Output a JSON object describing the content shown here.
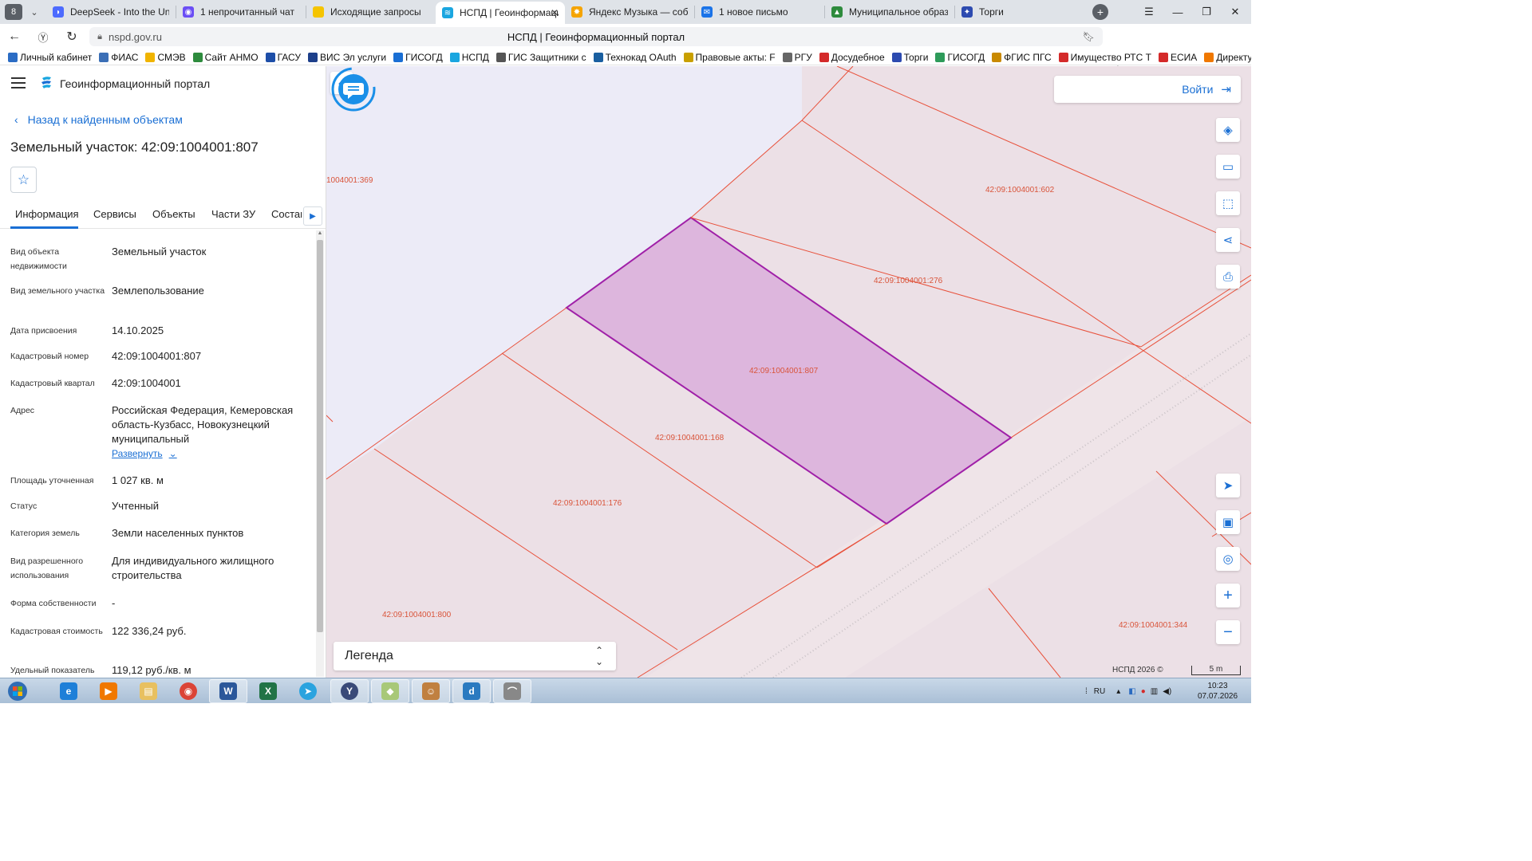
{
  "browser": {
    "tab_count": "8",
    "tabs": [
      {
        "label": "DeepSeek - Into the Unkno",
        "color": "#4d6bfe"
      },
      {
        "label": "1 непрочитанный чат",
        "color": "#6b4ef5"
      },
      {
        "label": "Исходящие запросы",
        "color": "#f5c400"
      },
      {
        "label": "НСПД | Геоинформаци",
        "color": "#1aa6e0"
      },
      {
        "label": "Яндекс Музыка — собира",
        "color": "#f5a400"
      },
      {
        "label": "1 новое письмо",
        "color": "#1a73e8"
      },
      {
        "label": "Муниципальное образов",
        "color": "#2e8b3d"
      },
      {
        "label": "Торги",
        "color": "#2d4bb0"
      }
    ],
    "tab_close": "✕",
    "new_tab": "+",
    "url": "nspd.gov.ru",
    "page_title": "НСПД | Геоинформационный портал",
    "bookmarks": [
      {
        "label": "Личный кабинет",
        "color": "#2b6cc4"
      },
      {
        "label": "ФИАС",
        "color": "#3b6fb6"
      },
      {
        "label": "СМЭВ",
        "color": "#f0b400"
      },
      {
        "label": "Сайт АНМО",
        "color": "#2e8b3d"
      },
      {
        "label": "ГАСУ",
        "color": "#1d4ea8"
      },
      {
        "label": "ВИС Эл услуги",
        "color": "#1d3f8a"
      },
      {
        "label": "ГИСОГД",
        "color": "#1a6fd4"
      },
      {
        "label": "НСПД",
        "color": "#1aa6e0"
      },
      {
        "label": "ГИС Защитники с",
        "color": "#555555"
      },
      {
        "label": "Технокад OAuth",
        "color": "#1a5fa0"
      },
      {
        "label": "Правовые акты: F",
        "color": "#c9a000"
      },
      {
        "label": "РГУ",
        "color": "#666666"
      },
      {
        "label": "Досудебное",
        "color": "#d42a2a"
      },
      {
        "label": "Торги",
        "color": "#2d4bb0"
      },
      {
        "label": "ГИСОГД",
        "color": "#2e9b5a"
      },
      {
        "label": "ФГИС ПГС",
        "color": "#c98a00"
      },
      {
        "label": "Имущество РТС Т",
        "color": "#d42a2a"
      },
      {
        "label": "ЕСИА",
        "color": "#d42a2a"
      },
      {
        "label": "Директум РХ",
        "color": "#f07800"
      }
    ]
  },
  "panel": {
    "portal_title": "Геоинформационный портал",
    "back_link": "Назад к найденным объектам",
    "object_title": "Земельный участок: 42:09:1004001:807",
    "tabs": [
      "Информация",
      "Сервисы",
      "Объекты",
      "Части ЗУ",
      "Состав"
    ],
    "properties": [
      {
        "key": "Вид объекта недвижимости",
        "value": "Земельный участок"
      },
      {
        "key": "Вид земельного участка",
        "value": "Землепользование"
      },
      {
        "key": "Дата присвоения",
        "value": "14.10.2025"
      },
      {
        "key": "Кадастровый номер",
        "value": "42:09:1004001:807"
      },
      {
        "key": "Кадастровый квартал",
        "value": "42:09:1004001"
      },
      {
        "key": "Адрес",
        "value": "Российская Федерация, Кемеровская область-Кузбасс, Новокузнецкий муниципальный"
      },
      {
        "key": "Площадь уточненная",
        "value": "1 027 кв. м"
      },
      {
        "key": "Статус",
        "value": "Учтенный"
      },
      {
        "key": "Категория земель",
        "value": "Земли населенных пунктов"
      },
      {
        "key": "Вид разрешенного использования",
        "value": "Для индивидуального жилищного строительства"
      },
      {
        "key": "Форма собственности",
        "value": "-"
      },
      {
        "key": "Кадастровая стоимость",
        "value": "122 336,24 руб."
      },
      {
        "key": "Удельный показатель",
        "value": "119,12 руб./кв. м"
      }
    ],
    "expand_label": "Развернуть"
  },
  "map": {
    "login_label": "Войти",
    "legend_label": "Легенда",
    "copyright": "НСПД 2026 ©",
    "scale": "5 m",
    "parcel_labels": [
      "1004001:369",
      "42:09:1004001:602",
      "42:09:1004001:276",
      "42:09:1004001:807",
      "42:09:1004001:168",
      "42:09:1004001:176",
      "42:09:1004001:800",
      "42:09:1004001:344"
    ],
    "colors": {
      "selected_fill": "#ddb6dd",
      "selected_stroke": "#a020a8",
      "boundary": "#e8503a",
      "label": "#d9543a",
      "accent": "#1a6fd4"
    }
  },
  "taskbar": {
    "lang": "RU",
    "time": "10:23",
    "date": "07.07.2026"
  }
}
